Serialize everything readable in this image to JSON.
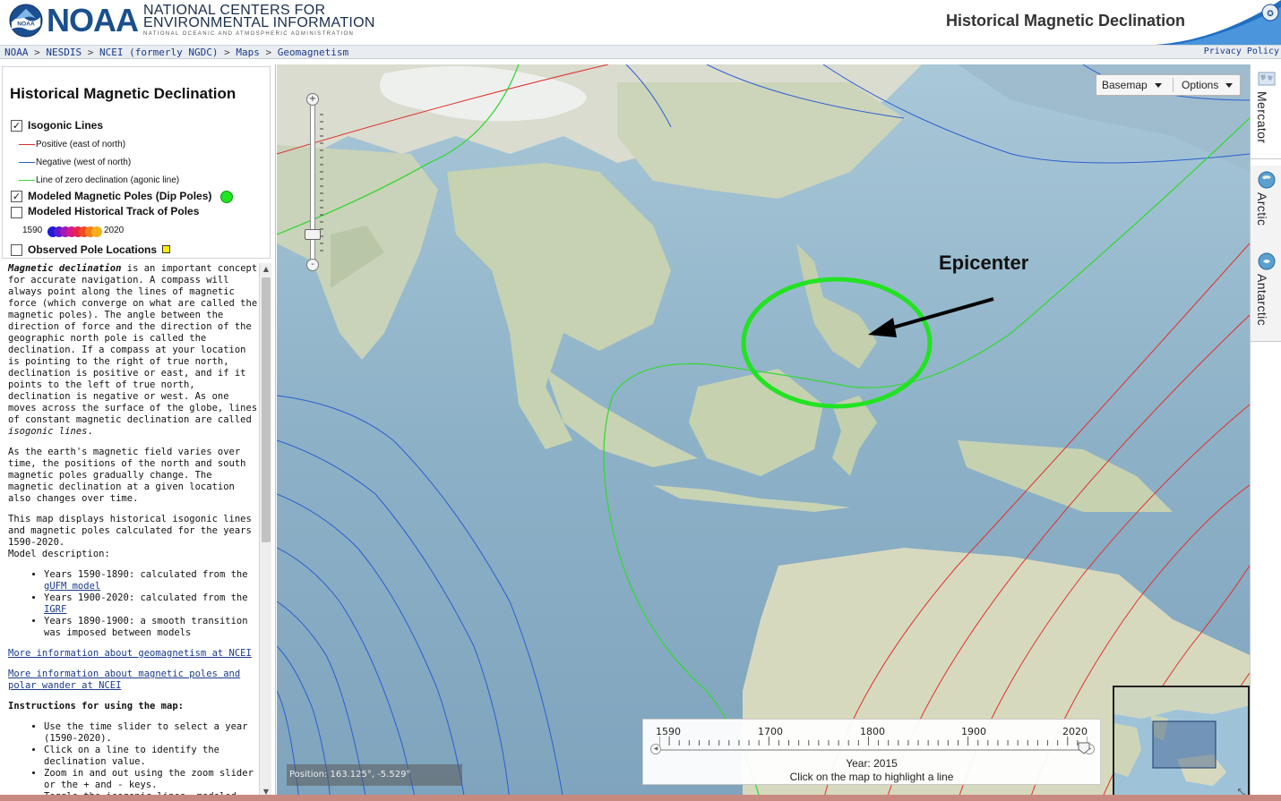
{
  "header": {
    "logo_text": "NOAA",
    "org_line1": "NATIONAL CENTERS FOR",
    "org_line2": "ENVIRONMENTAL INFORMATION",
    "org_line3": "NATIONAL OCEANIC AND ATMOSPHERIC ADMINISTRATION",
    "page_title": "Historical Magnetic Declination"
  },
  "breadcrumb": {
    "items": [
      "NOAA",
      "NESDIS",
      "NCEI (formerly NGDC)",
      "Maps",
      "Geomagnetism"
    ],
    "separator": ">",
    "privacy": "Privacy Policy"
  },
  "legend": {
    "title": "Historical Magnetic Declination",
    "isogonic": {
      "label": "Isogonic Lines",
      "checked": true
    },
    "positive": {
      "label": "Positive (east of north)",
      "color": "#e0302a"
    },
    "negative": {
      "label": "Negative (west of north)",
      "color": "#2a5fd0"
    },
    "agonic": {
      "label": "Line of zero declination (agonic line)",
      "color": "#39d63a"
    },
    "poles": {
      "label": "Modeled Magnetic Poles (Dip Poles)",
      "checked": true,
      "color": "#22e322"
    },
    "track": {
      "label": "Modeled Historical Track of Poles",
      "checked": false,
      "start": "1590",
      "end": "2020"
    },
    "observed": {
      "label": "Observed Pole Locations",
      "checked": false,
      "color": "#ffee00"
    }
  },
  "description": {
    "p1_term": "Magnetic declination",
    "p1_text": " is an important concept for accurate navigation. A compass will always point along the lines of magnetic force (which converge on what are called the magnetic poles). The angle between the direction of force and the direction of the geographic north pole is called the declination. If a compass at your location is pointing to the right of true north, declination is positive or east, and if it points to the left of true north, declination is negative or west. As one moves across the surface of the globe, lines of constant magnetic declination are called ",
    "p1_term2": "isogonic lines",
    "p1_end": ".",
    "p2": "As the earth's magnetic field varies over time, the positions of the north and south magnetic poles gradually change. The magnetic declination at a given location also changes over time.",
    "p3": "This map displays historical isogonic lines and magnetic poles calculated for the years 1590-2020.",
    "p3b": "Model description:",
    "models": [
      {
        "text": "Years 1590-1890: calculated from the ",
        "link": "gUFM model"
      },
      {
        "text": "Years 1900-2020: calculated from the ",
        "link": "IGRF"
      },
      {
        "text": "Years 1890-1900: a smooth transition was imposed between models",
        "link": ""
      }
    ],
    "link1": "More information about geomagnetism at NCEI",
    "link2": "More information about magnetic poles and polar wander at NCEI",
    "instructions_title": "Instructions for using the map:",
    "instructions": [
      "Use the time slider to select a year (1590-2020).",
      "Click on a line to identify the declination value.",
      "Zoom in and out using the zoom slider or the + and - keys.",
      "Toggle the isogonic lines, modeled pole"
    ]
  },
  "map": {
    "annotation": "Epicenter",
    "annotation_color": "#22e322",
    "position": "Position: 163.125°, -5.529°",
    "toolbar": {
      "basemap": "Basemap",
      "options": "Options"
    },
    "zoom": {
      "plus": "+",
      "minus": "-",
      "level_fraction": 0.2
    }
  },
  "time_slider": {
    "labels": [
      "1590",
      "1700",
      "1800",
      "1900",
      "2020"
    ],
    "min": 1590,
    "max": 2020,
    "selected": 2015,
    "year_text": "Year: 2015",
    "hint": "Click on the map to highlight a line"
  },
  "projections": {
    "items": [
      {
        "label": "Mercator",
        "icon": "mercator-icon",
        "active": true
      },
      {
        "label": "Arctic",
        "icon": "arctic-globe-icon",
        "active": false
      },
      {
        "label": "Antarctic",
        "icon": "antarctic-globe-icon",
        "active": false
      }
    ]
  }
}
